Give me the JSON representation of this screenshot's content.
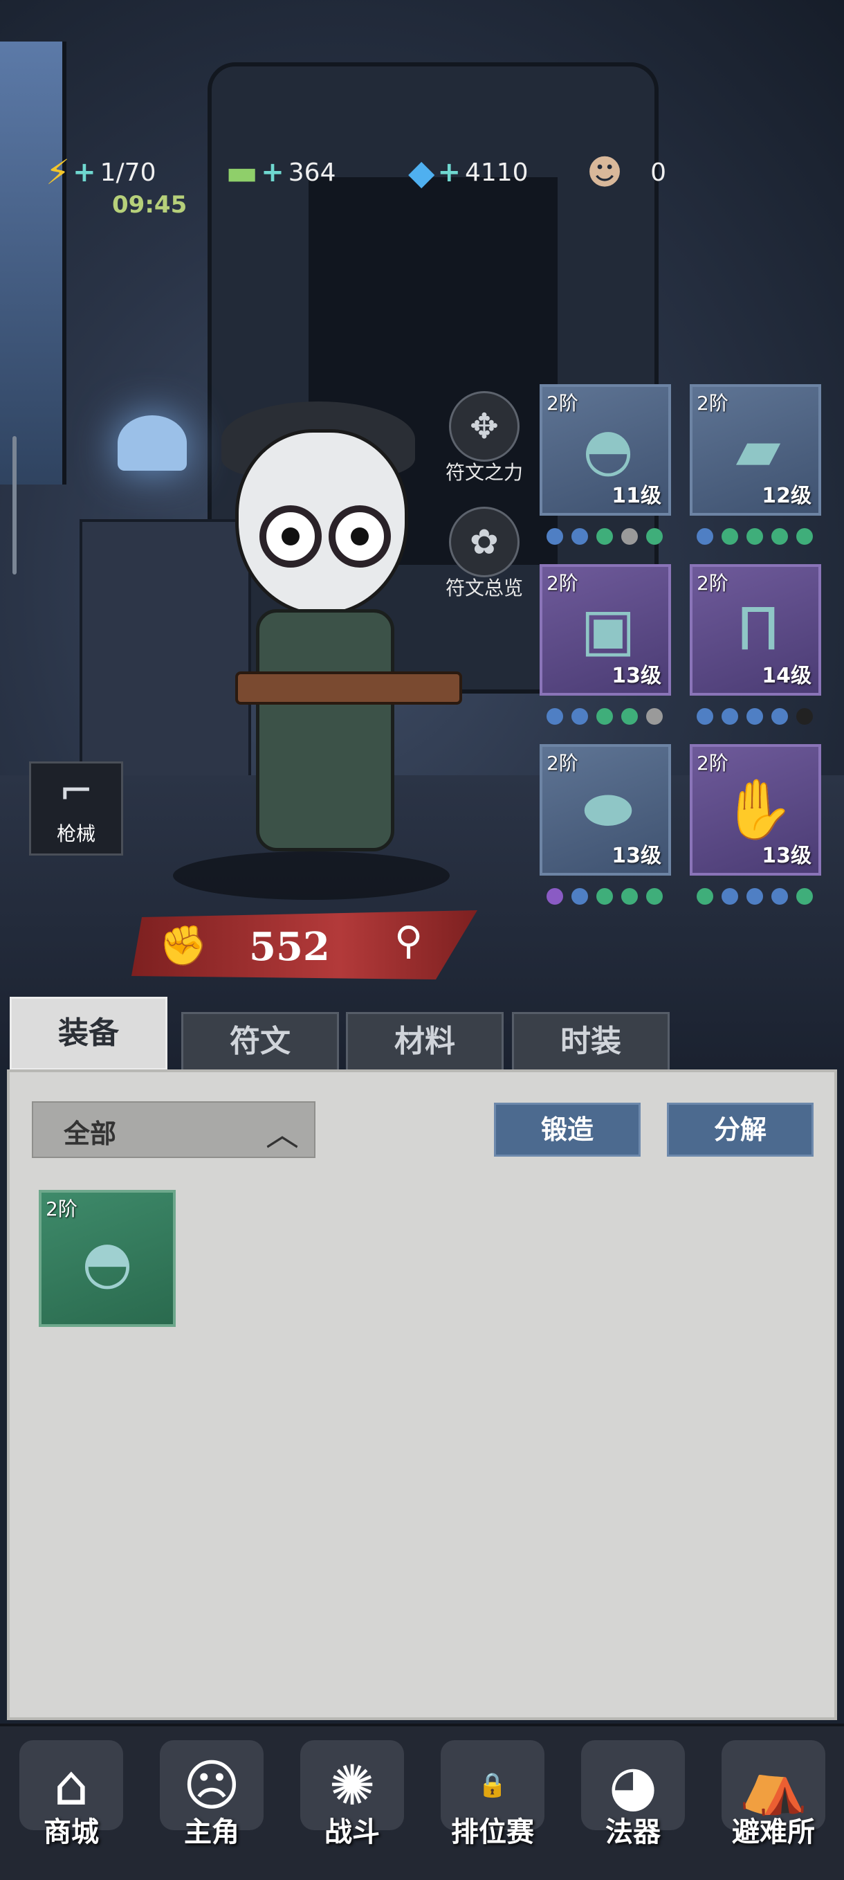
{
  "resources": {
    "energy": {
      "value": "1/70",
      "timer": "09:45",
      "icon": "lightning-icon"
    },
    "cash": {
      "value": "364",
      "icon": "cash-icon"
    },
    "gems": {
      "value": "4110",
      "icon": "gem-icon"
    },
    "ally": {
      "value": "0",
      "icon": "character-head-icon"
    }
  },
  "side_buttons": {
    "rune_power": "符文之力",
    "rune_overview": "符文总览",
    "weapon": "枪械"
  },
  "power": {
    "value": "552"
  },
  "equipment_slots": [
    {
      "tier": "2阶",
      "level": "11级",
      "item": "cap",
      "rarity": "blue",
      "gems": [
        "#4f7fc4",
        "#4f7fc4",
        "#3fae7a",
        "#9a9a9a",
        "#3fae7a"
      ]
    },
    {
      "tier": "2阶",
      "level": "12级",
      "item": "torn-cloth",
      "rarity": "blue",
      "gems": [
        "#4f7fc4",
        "#3fae7a",
        "#3fae7a",
        "#3fae7a",
        "#3fae7a"
      ]
    },
    {
      "tier": "2阶",
      "level": "13级",
      "item": "jacket",
      "rarity": "purple",
      "gems": [
        "#4f7fc4",
        "#4f7fc4",
        "#3fae7a",
        "#3fae7a",
        "#9a9a9a"
      ]
    },
    {
      "tier": "2阶",
      "level": "14级",
      "item": "pants",
      "rarity": "purple",
      "gems": [
        "#4f7fc4",
        "#4f7fc4",
        "#4f7fc4",
        "#4f7fc4",
        "#222222"
      ]
    },
    {
      "tier": "2阶",
      "level": "13级",
      "item": "shoes",
      "rarity": "blue",
      "gems": [
        "#8a5bc4",
        "#4f7fc4",
        "#3fae7a",
        "#3fae7a",
        "#3fae7a"
      ]
    },
    {
      "tier": "2阶",
      "level": "13级",
      "item": "gloves",
      "rarity": "purple",
      "gems": [
        "#3fae7a",
        "#4f7fc4",
        "#4f7fc4",
        "#4f7fc4",
        "#3fae7a"
      ]
    }
  ],
  "tabs": [
    "装备",
    "符文",
    "材料",
    "时装"
  ],
  "panel": {
    "filter_label": "全部",
    "forge_label": "锻造",
    "decompose_label": "分解",
    "inventory": [
      {
        "tier": "2阶",
        "item": "cap"
      }
    ]
  },
  "nav": [
    {
      "label": "商城",
      "icon": "shop-icon"
    },
    {
      "label": "主角",
      "icon": "hero-icon"
    },
    {
      "label": "战斗",
      "icon": "battle-icon"
    },
    {
      "label": "排位赛",
      "icon": "ranked-icon",
      "locked": true
    },
    {
      "label": "法器",
      "icon": "artifact-icon"
    },
    {
      "label": "避难所",
      "icon": "shelter-icon"
    }
  ]
}
